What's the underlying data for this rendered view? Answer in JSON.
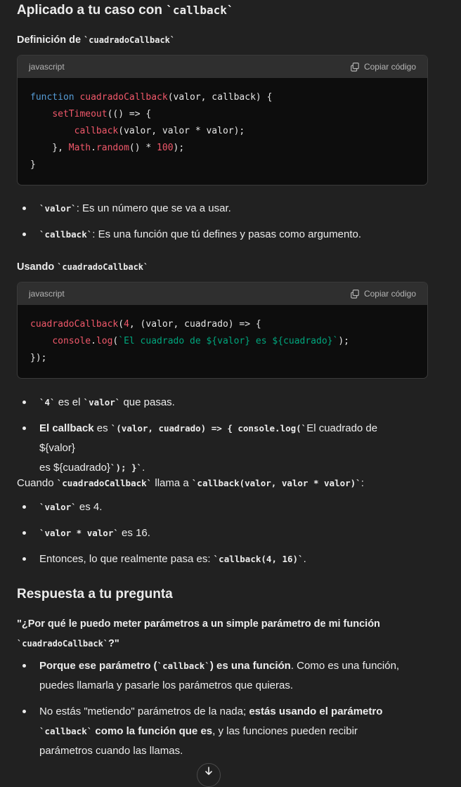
{
  "heading1": {
    "prefix": "Aplicado a tu caso con ",
    "code": "`callback`"
  },
  "def_heading": {
    "prefix": "Definición de ",
    "code": "`cuadradoCallback`"
  },
  "block1": {
    "lang": "javascript",
    "copy_label": "Copiar código",
    "lines": [
      "function cuadradoCallback(valor, callback) {",
      "    setTimeout(() => {",
      "        callback(valor, valor * valor);",
      "    }, Math.random() * 100);",
      "}"
    ]
  },
  "bullets1": [
    {
      "code": "`valor`",
      "text": ": Es un número que se va a usar."
    },
    {
      "code": "`callback`",
      "text": ": Es una función que tú defines y pasas como argumento."
    }
  ],
  "usando_heading": {
    "prefix": "Usando ",
    "code": "`cuadradoCallback`"
  },
  "block2": {
    "lang": "javascript",
    "copy_label": "Copiar código",
    "lines": [
      "cuadradoCallback(4, (valor, cuadrado) => {",
      "    console.log(`El cuadrado de ${valor} es ${cuadrado}`);",
      "});"
    ]
  },
  "bullets2": {
    "b1": {
      "code1": "`4`",
      "mid": " es el ",
      "code2": "`valor`",
      "end": " que pasas."
    },
    "b2": {
      "bold": "El callback",
      "mid": " es ",
      "code": "`(valor, cuadrado) => { console.log(`",
      "rest1": "El cuadrado de ${valor}",
      "rest2": "es ${cuadrado}",
      "code_end": "`); }`",
      "end": "."
    }
  },
  "cuando": {
    "prefix": "Cuando ",
    "code1": "`cuadradoCallback`",
    "mid": " llama a ",
    "code2": "`callback(valor, valor * valor)`",
    "end": ":"
  },
  "bullets3": [
    {
      "code": "`valor`",
      "text": " es 4."
    },
    {
      "code": "`valor * valor`",
      "text": " es 16."
    },
    {
      "prefix": "Entonces, lo que realmente pasa es: ",
      "code": "`callback(4, 16)`",
      "text": "."
    }
  ],
  "heading2": "Respuesta a tu pregunta",
  "question": {
    "line1": "\"¿Por qué le puedo meter parámetros a un simple parámetro de mi función",
    "code": "`cuadradoCallback`",
    "end": "?\""
  },
  "bullets4": {
    "b1": {
      "bold1": "Porque ese parámetro (",
      "code": "`callback`",
      "bold2": ") es una función",
      "text1": ". Como es una función,",
      "text2": "puedes llamarla y pasarle los parámetros que quieras."
    },
    "b2": {
      "text1": "No estás \"metiendo\" parámetros de la nada; ",
      "bold1": "estás usando el parámetro",
      "code": "`callback`",
      "bold2": " como la función que es",
      "text2": ", y las funciones pueden recibir",
      "text3": "parámetros cuando las llamas."
    }
  }
}
